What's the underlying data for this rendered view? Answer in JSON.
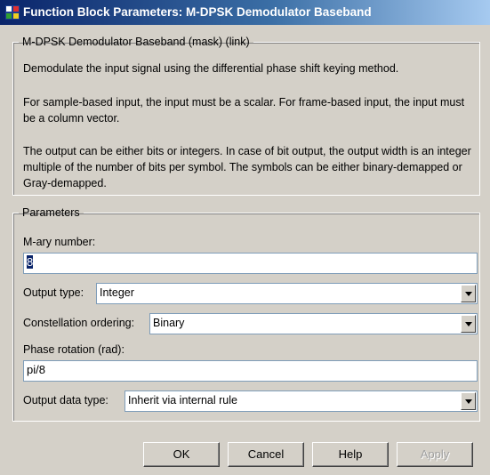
{
  "window": {
    "title": "Function Block Parameters: M-DPSK Demodulator Baseband",
    "icon": "simulink-block-icon"
  },
  "mask": {
    "group_title": "M-DPSK Demodulator Baseband (mask) (link)",
    "paragraphs": [
      "Demodulate the input signal using the differential phase shift keying method.",
      "For sample-based input, the input must be a scalar. For frame-based input, the input must be a column vector.",
      "The output can be either bits or integers. In case of bit output, the output width is an integer multiple of the number of bits per symbol. The symbols can be either binary-demapped or Gray-demapped."
    ]
  },
  "parameters": {
    "group_title": "Parameters",
    "mary_label": "M-ary number:",
    "mary_value": "8",
    "output_type_label": "Output type:",
    "output_type_value": "Integer",
    "constellation_label": "Constellation ordering:",
    "constellation_value": "Binary",
    "phase_label": "Phase rotation (rad):",
    "phase_value": "pi/8",
    "output_data_type_label": "Output data type:",
    "output_data_type_value": "Inherit via internal rule"
  },
  "buttons": {
    "ok": "OK",
    "cancel": "Cancel",
    "help": "Help",
    "apply": "Apply"
  },
  "colors": {
    "title_gradient_start": "#0a246a",
    "title_gradient_end": "#a6caf0",
    "face": "#d4d0c8",
    "selection": "#0a246a"
  }
}
